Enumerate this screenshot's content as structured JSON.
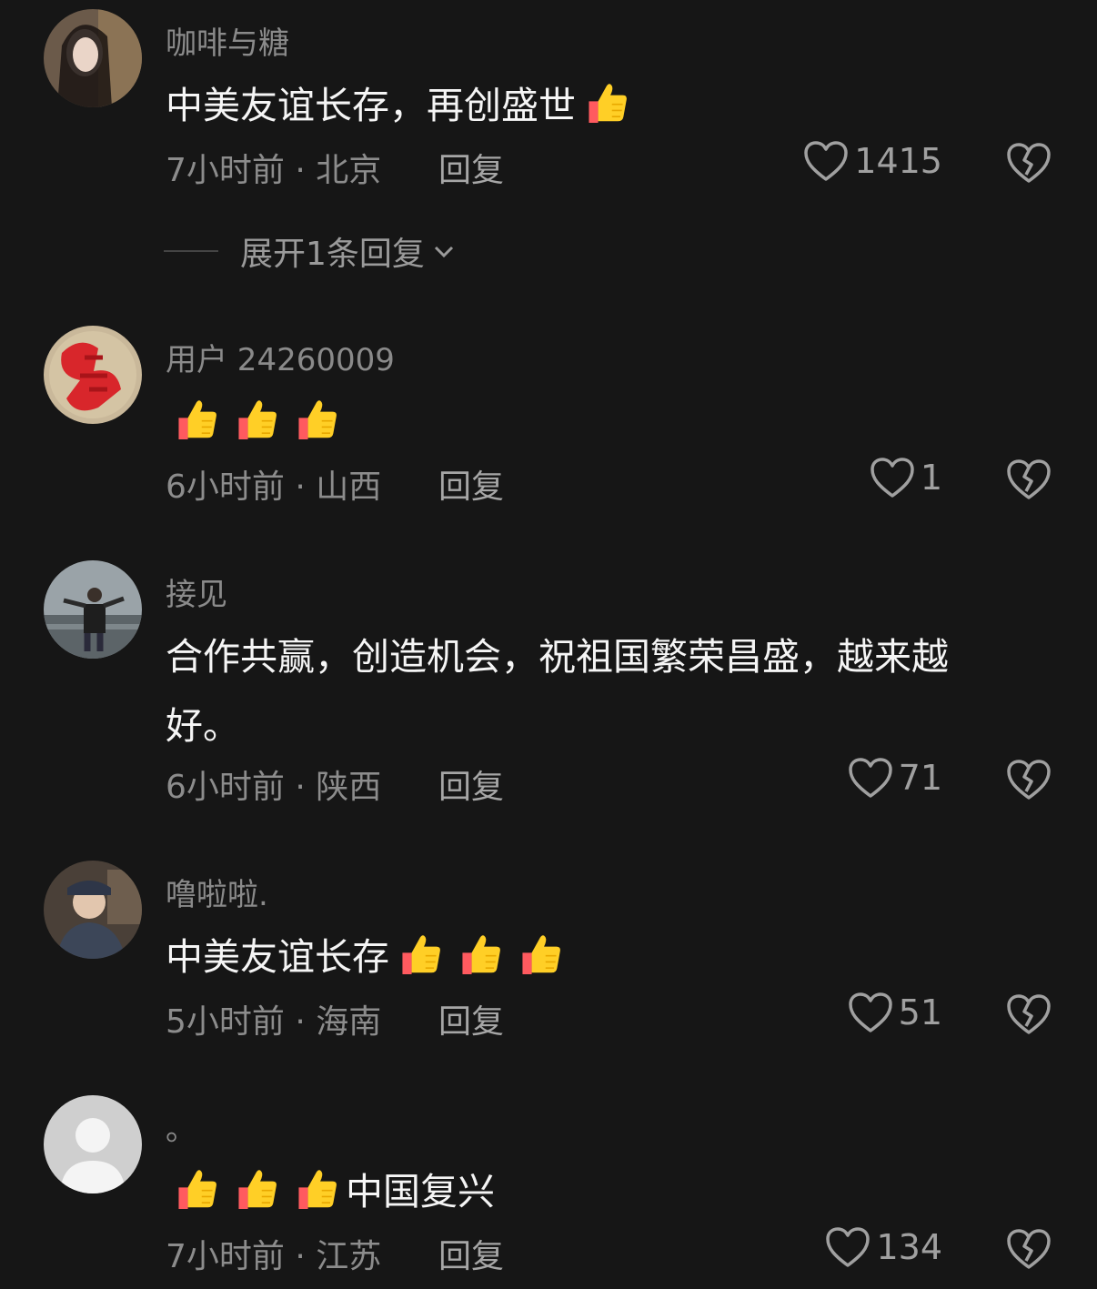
{
  "comments": [
    {
      "username": "咖啡与糖",
      "text": "中美友谊长存，再创盛世",
      "emoji_before": 0,
      "emoji_after": 1,
      "time_location": "7小时前 · 北京",
      "reply": "回复",
      "likes": "1415",
      "expand": "展开1条回复"
    },
    {
      "username": "用户 24260009",
      "text": "",
      "emoji_before": 3,
      "emoji_after": 0,
      "time_location": "6小时前 · 山西",
      "reply": "回复",
      "likes": "1"
    },
    {
      "username": "接见",
      "text": "合作共赢，创造机会，祝祖国繁荣昌盛，越来越好。",
      "emoji_before": 0,
      "emoji_after": 0,
      "time_location": "6小时前 · 陕西",
      "reply": "回复",
      "likes": "71"
    },
    {
      "username": "噜啦啦.",
      "text": "中美友谊长存",
      "emoji_before": 0,
      "emoji_after": 3,
      "time_location": "5小时前 · 海南",
      "reply": "回复",
      "likes": "51"
    },
    {
      "username": "。",
      "text": "中国复兴",
      "emoji_before": 3,
      "emoji_after": 0,
      "time_location": "7小时前 · 江苏",
      "reply": "回复",
      "likes": "134"
    }
  ],
  "icons": {
    "like": "heart-outline-icon",
    "dislike": "broken-heart-icon",
    "expand": "chevron-down-icon",
    "emoji": "thumbs-up-emoji"
  },
  "colors": {
    "background": "#161616",
    "text": "#f5f5f5",
    "muted": "#8c8c8c"
  }
}
